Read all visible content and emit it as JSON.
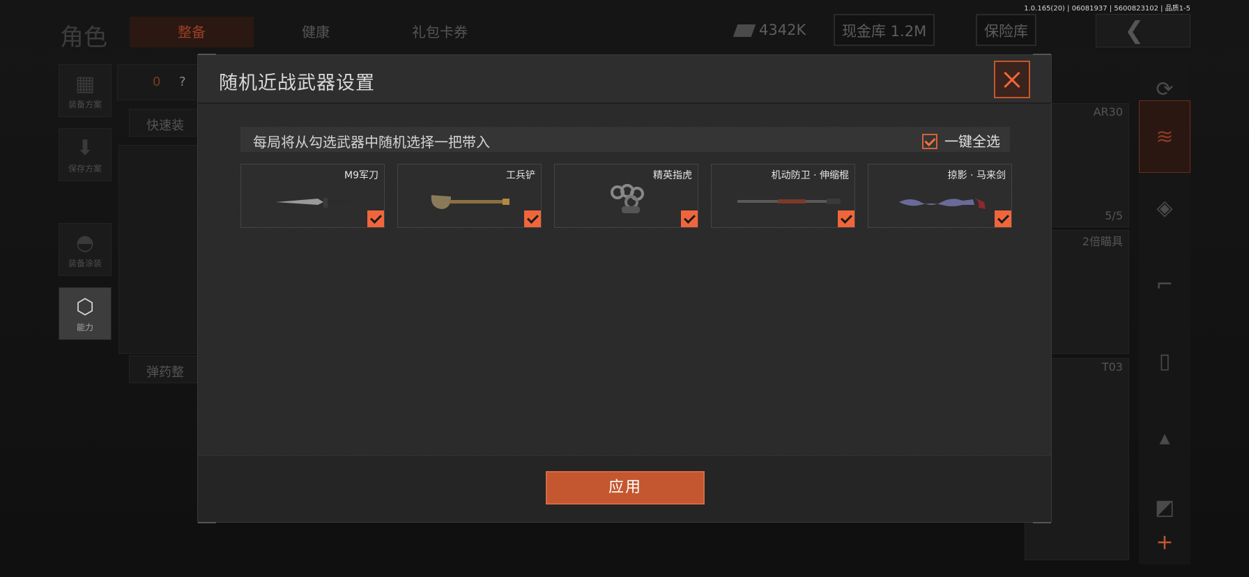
{
  "version": "1.0.165(20) | 06081937 | 5600823102 | 品质1-5",
  "page_title": "角色",
  "tabs": [
    {
      "label": "整备",
      "active": true
    },
    {
      "label": "健康",
      "active": false
    },
    {
      "label": "礼包卡券",
      "active": false
    }
  ],
  "currency": {
    "money": "4342K",
    "cash_vault": "现金库 1.2M",
    "safe_box": "保险库"
  },
  "sidebar": {
    "items": [
      {
        "label": "装备方案",
        "icon": "vest-icon"
      },
      {
        "label": "保存方案",
        "icon": "download-icon"
      },
      {
        "label": "装备涂装",
        "icon": "helmet-icon"
      },
      {
        "label": "能力",
        "icon": "ability-icon",
        "active": true
      }
    ]
  },
  "middle": {
    "count": "0",
    "unknown": "?",
    "quick_equip": "快速装",
    "ammo": "弹药整"
  },
  "right_slots": {
    "slot1_name": "AR30",
    "slot1_count": "5/5",
    "slot2_name": "2倍瞄具",
    "slot3_name": "T03"
  },
  "modal": {
    "title": "随机近战武器设置",
    "info": "每局将从勾选武器中随机选择一把带入",
    "select_all": "一键全选",
    "apply": "应用",
    "weapons": [
      {
        "name": "M9军刀",
        "icon": "knife-icon",
        "checked": true
      },
      {
        "name": "工兵铲",
        "icon": "shovel-icon",
        "checked": true
      },
      {
        "name": "精英指虎",
        "icon": "knuckles-icon",
        "checked": true
      },
      {
        "name": "机动防卫 · 伸缩棍",
        "icon": "baton-icon",
        "checked": true
      },
      {
        "name": "掠影 · 马来剑",
        "icon": "kris-sword-icon",
        "checked": true
      }
    ]
  },
  "colors": {
    "accent": "#f0663a",
    "accent_dark": "#c4572f",
    "modal_bg": "#2a2a2a"
  }
}
